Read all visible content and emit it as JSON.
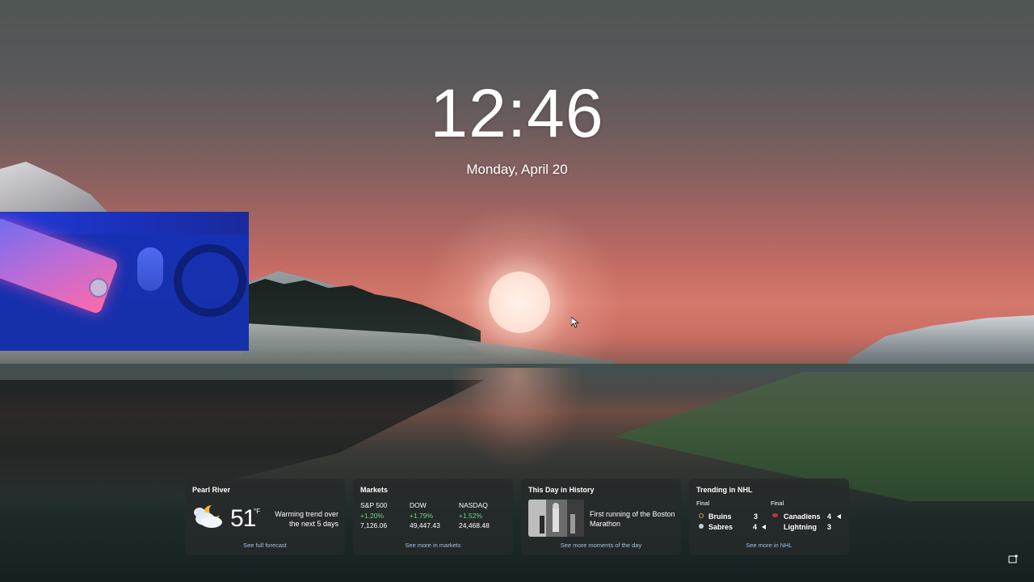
{
  "lockscreen": {
    "time": "12:46",
    "date": "Monday, April 20"
  },
  "widgets": {
    "weather": {
      "title": "Pearl River",
      "temperature": "51",
      "unit": "°F",
      "description": "Warming trend over the next 5 days",
      "link": "See full forecast",
      "icon": "partly-cloudy-night-icon"
    },
    "markets": {
      "title": "Markets",
      "indexes": [
        {
          "name": "S&P 500",
          "change": "+1.20%",
          "value": "7,126.06"
        },
        {
          "name": "DOW",
          "change": "+1.79%",
          "value": "49,447.43"
        },
        {
          "name": "NASDAQ",
          "change": "+1.52%",
          "value": "24,468.48"
        }
      ],
      "link": "See more in markets",
      "positive_color": "#6fd48a"
    },
    "history": {
      "title": "This Day in History",
      "headline": "First running of the Boston Marathon",
      "link": "See more moments of the day"
    },
    "nhl": {
      "title": "Trending in NHL",
      "games": [
        {
          "status": "Final",
          "teams": [
            {
              "name": "Bruins",
              "score": "3"
            },
            {
              "name": "Sabres",
              "score": "4"
            }
          ]
        },
        {
          "status": "Final",
          "teams": [
            {
              "name": "Canadiens",
              "score": "4"
            },
            {
              "name": "Lightning",
              "score": "3"
            }
          ]
        }
      ],
      "link": "See more in NHL"
    }
  },
  "colors": {
    "link": "#9fc2e6",
    "widget_bg": "#262a2a"
  }
}
